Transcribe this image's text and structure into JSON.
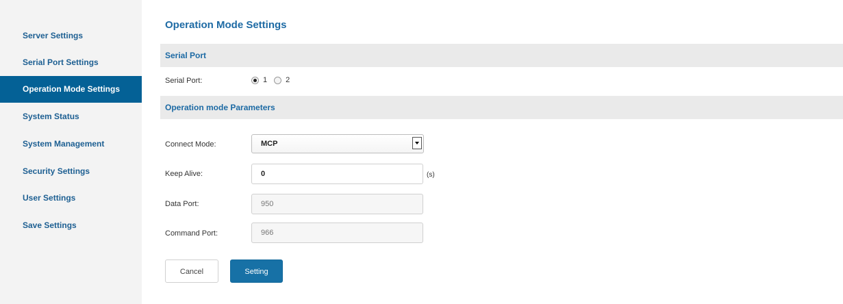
{
  "sidebar": {
    "items": [
      {
        "label": "Server Settings"
      },
      {
        "label": "Serial Port Settings"
      },
      {
        "label": "Operation Mode Settings",
        "active": true
      },
      {
        "label": "System Status"
      },
      {
        "label": "System Management"
      },
      {
        "label": "Security Settings"
      },
      {
        "label": "User Settings"
      },
      {
        "label": "Save Settings"
      }
    ]
  },
  "main": {
    "title": "Operation Mode Settings",
    "serial_section": {
      "header": "Serial Port",
      "label": "Serial Port:",
      "options": [
        "1",
        "2"
      ],
      "selected": "1"
    },
    "params_section": {
      "header": "Operation mode Parameters",
      "connect_mode": {
        "label": "Connect Mode:",
        "value": "MCP"
      },
      "keep_alive": {
        "label": "Keep Alive:",
        "value": "0",
        "unit": "(s)"
      },
      "data_port": {
        "label": "Data Port:",
        "value": "950"
      },
      "command_port": {
        "label": "Command Port:",
        "value": "966"
      }
    },
    "buttons": {
      "cancel": "Cancel",
      "submit": "Setting"
    }
  },
  "colors": {
    "accent": "#046196",
    "link": "#1d5f92",
    "section_bg": "#eaeaea",
    "sidebar_bg": "#f3f3f3"
  }
}
